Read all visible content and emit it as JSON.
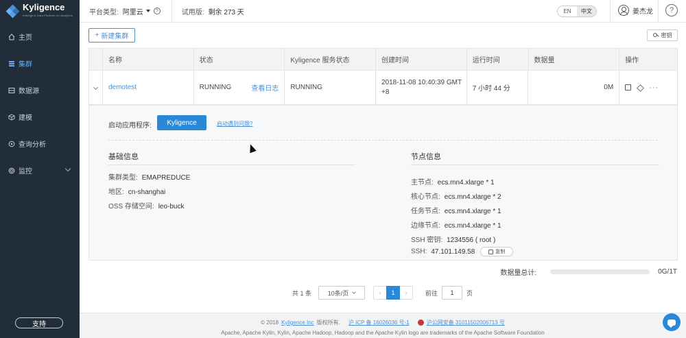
{
  "brand": {
    "name": "Kyligence",
    "tagline": "Intelligent Data Platform for Analytics"
  },
  "sidebar": {
    "items": [
      {
        "label": "主页",
        "icon": "home-icon"
      },
      {
        "label": "集群",
        "icon": "cluster-icon",
        "active": true
      },
      {
        "label": "数据源",
        "icon": "datasource-icon"
      },
      {
        "label": "建模",
        "icon": "model-icon"
      },
      {
        "label": "查询分析",
        "icon": "query-icon"
      },
      {
        "label": "监控",
        "icon": "monitor-icon"
      }
    ],
    "support_label": "支持"
  },
  "header": {
    "platform_label": "平台类型:",
    "platform_value": "阿里云",
    "trial_label": "试用版:",
    "trial_value": "剩余 273 天",
    "lang_en": "EN",
    "lang_zh": "中文",
    "user_name": "姜杰龙",
    "help": "?"
  },
  "toolbar": {
    "new_cluster": "新建集群",
    "key_button": "密钥"
  },
  "table": {
    "columns": [
      "名称",
      "状态",
      "Kyligence 服务状态",
      "创建时间",
      "运行时间",
      "数据量",
      "操作"
    ],
    "row": {
      "name": "demotest",
      "status": "RUNNING",
      "log_link": "查看日志",
      "service_status": "RUNNING",
      "created": "2018-11-08 10:40:39 GMT +8",
      "runtime": "7 小时 44 分",
      "data_size": "0M"
    }
  },
  "detail": {
    "launch_label": "启动应用程序:",
    "launch_button": "Kyligence",
    "launch_help": "启动遇到问题?",
    "basic": {
      "title": "基础信息",
      "cluster_type_label": "集群类型:",
      "cluster_type": "EMAPREDUCE",
      "region_label": "地区:",
      "region": "cn-shanghai",
      "oss_label": "OSS 存储空间:",
      "oss": "leo-buck"
    },
    "nodes": {
      "title": "节点信息",
      "master_label": "主节点:",
      "master": "ecs.mn4.xlarge * 1",
      "core_label": "核心节点:",
      "core": "ecs.mn4.xlarge * 2",
      "task_label": "任务节点:",
      "task": "ecs.mn4.xlarge * 1",
      "edge_label": "边缘节点:",
      "edge": "ecs.mn4.xlarge * 1",
      "ssh_key_label": "SSH 密钥:",
      "ssh_key": "1234556 ( root )",
      "ssh_label": "SSH:",
      "ssh": "47.101.149.58",
      "copy": "复制"
    }
  },
  "total": {
    "label": "数据量总计:",
    "value": "0G/1T",
    "used_fraction": 0
  },
  "pager": {
    "total": "共 1 条",
    "page_size": "10条/页",
    "current": "1",
    "goto_label": "前往",
    "goto_value": "1",
    "page_unit": "页"
  },
  "footer": {
    "copyright": "© 2018",
    "company": "Kyligence Inc",
    "rights": "版权所有.",
    "icp": "沪 ICP 备 16026036 号-1",
    "police": "沪公网安备 31011502006713 号",
    "trademark": "Apache, Apache Kylin, Kylin, Apache Hadoop, Hadoop and the Apache Kylin logo are trademarks of the Apache Software Foundation"
  }
}
